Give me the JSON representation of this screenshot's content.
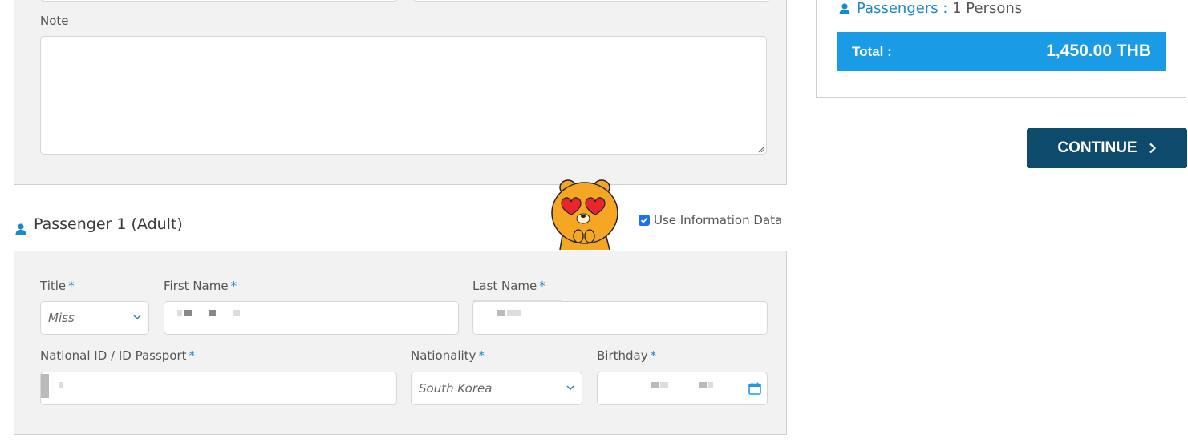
{
  "note_section": {
    "label": "Note",
    "value": ""
  },
  "passenger_section": {
    "title": "Passenger 1 (Adult)",
    "use_info_label": "Use Information Data",
    "use_info_checked": true,
    "fields": {
      "title_label": "Title",
      "title_value": "Miss",
      "first_name_label": "First Name",
      "last_name_label": "Last Name",
      "national_id_label": "National ID / ID Passport",
      "nationality_label": "Nationality",
      "nationality_value": "South Korea",
      "birthday_label": "Birthday",
      "required_marker": "*"
    }
  },
  "summary": {
    "passengers_label": "Passengers :",
    "passengers_value": "1 Persons",
    "total_label": "Total :",
    "total_value": "1,450.00 THB"
  },
  "actions": {
    "continue_label": "CONTINUE"
  },
  "icons": {
    "person": "person-icon",
    "chevron": "chevron-down-icon",
    "calendar": "calendar-icon",
    "continue_arrow": "chevron-right-icon"
  },
  "colors": {
    "accent": "#1a88c9",
    "total_bar": "#1a9be6",
    "continue_button": "#0d4a6b",
    "panel_bg": "#f2f2f2"
  }
}
